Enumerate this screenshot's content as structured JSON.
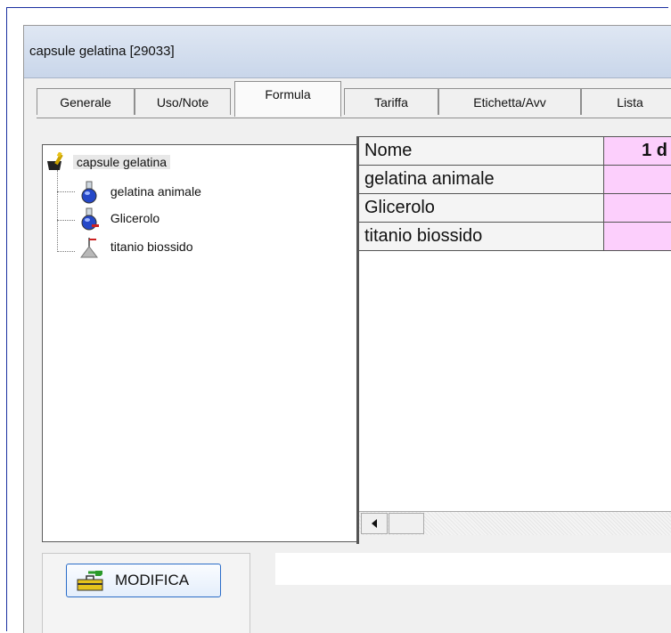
{
  "window": {
    "title": "capsule gelatina  [29033]"
  },
  "tabs": [
    {
      "label": "Generale"
    },
    {
      "label": "Uso/Note"
    },
    {
      "label": "Formula",
      "active": true
    },
    {
      "label": "Tariffa"
    },
    {
      "label": "Etichetta/Avv"
    },
    {
      "label": "Lista"
    }
  ],
  "tree": {
    "root": {
      "label": "capsule gelatina",
      "icon": "mortar-pestle-icon"
    },
    "children": [
      {
        "label": "gelatina animale",
        "icon": "flask-icon"
      },
      {
        "label": "Glicerolo",
        "icon": "flask-icon"
      },
      {
        "label": "titanio biossido",
        "icon": "funnel-icon"
      }
    ]
  },
  "grid": {
    "header": {
      "name": "Nome",
      "qty": "1 d"
    },
    "rows": [
      {
        "name": "gelatina animale",
        "qty": ""
      },
      {
        "name": "Glicerolo",
        "qty": ""
      },
      {
        "name": "titanio biossido",
        "qty": ""
      }
    ]
  },
  "buttons": {
    "modifica": "MODIFICA"
  },
  "colors": {
    "accent": "#1a2fa0",
    "cell_pink": "#fccffc"
  }
}
